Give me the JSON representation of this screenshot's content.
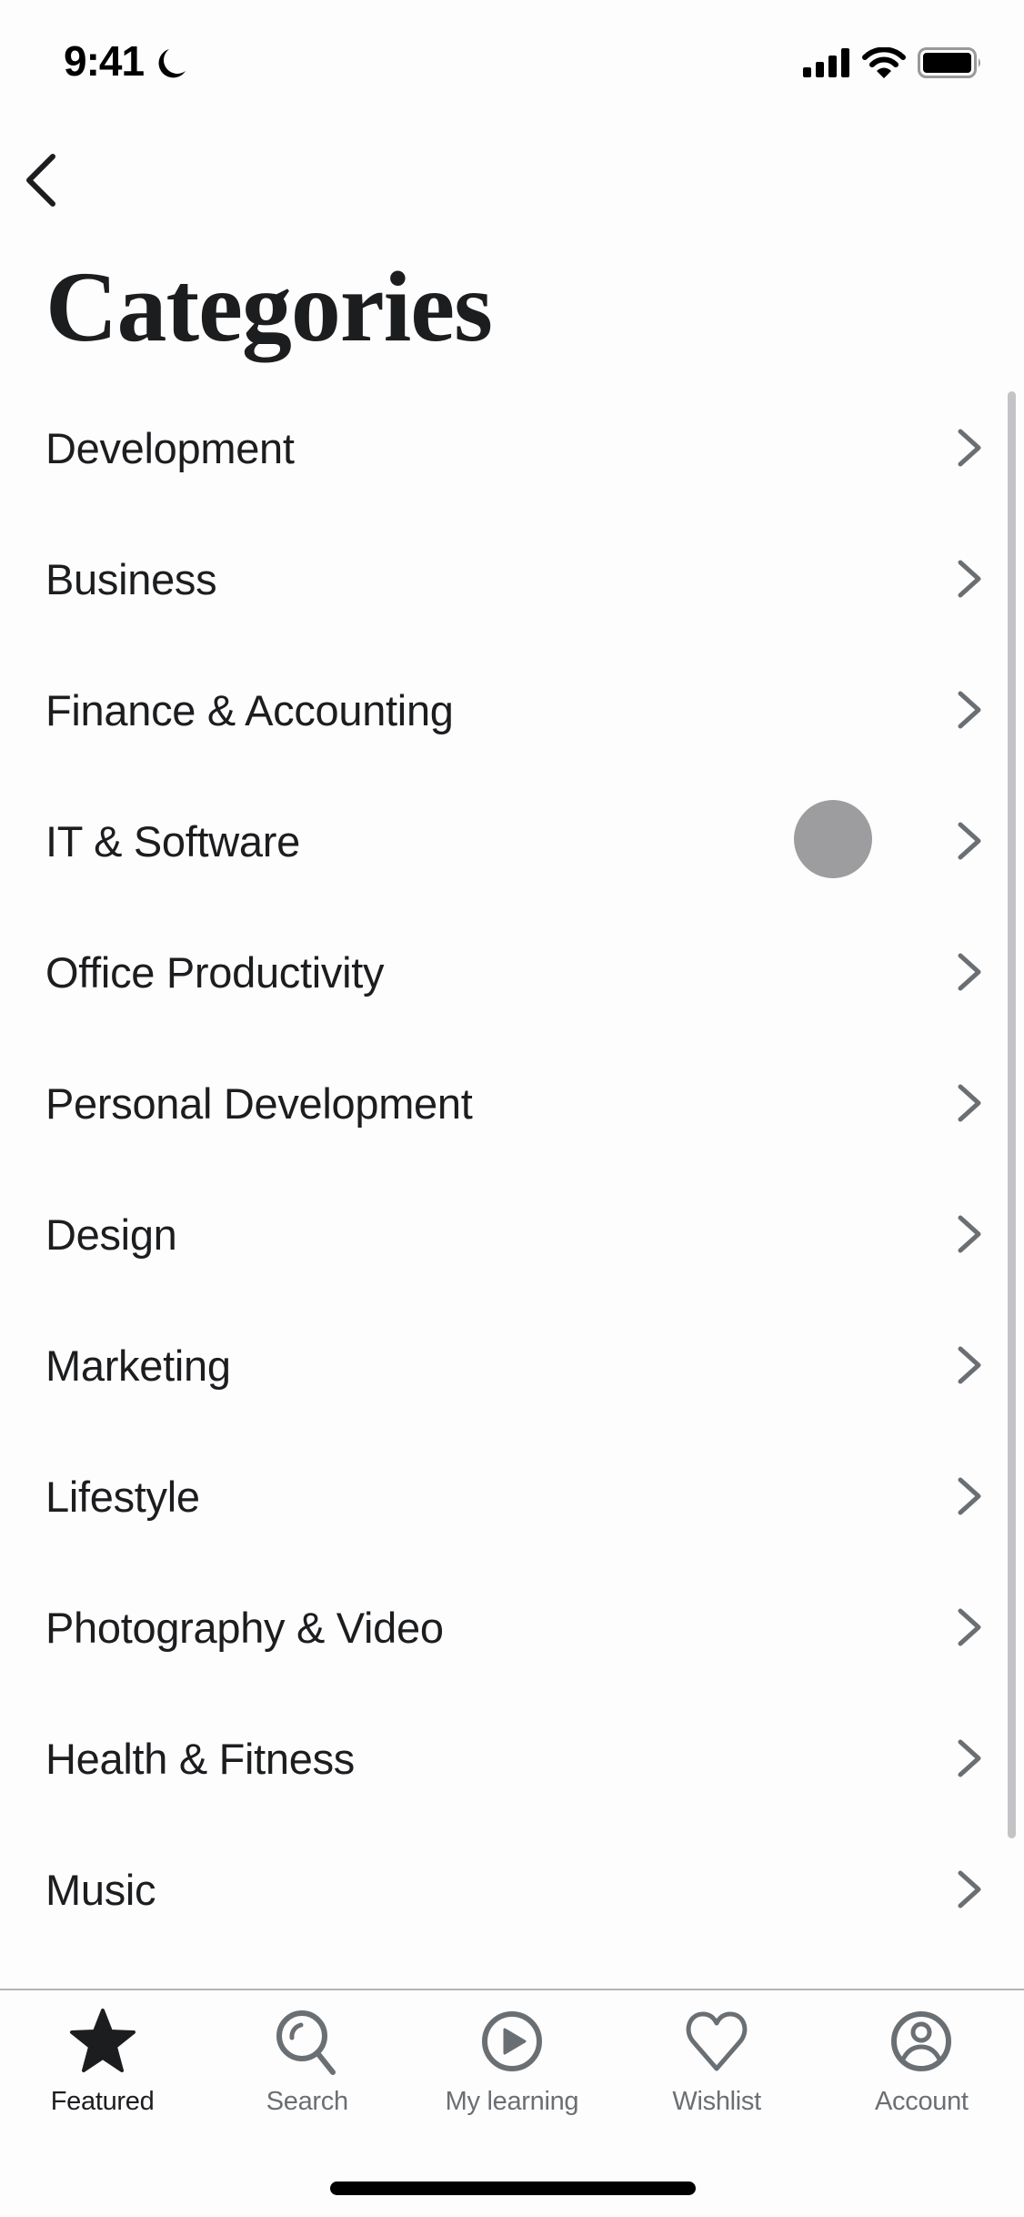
{
  "status_bar": {
    "time": "9:41",
    "focus_icon": "moon-icon",
    "signal_icon": "cellular-signal-icon",
    "wifi_icon": "wifi-icon",
    "battery_icon": "battery-icon"
  },
  "header": {
    "back_icon": "chevron-left-icon",
    "title": "Categories"
  },
  "categories": [
    {
      "label": "Development",
      "icon": "chevron-right-icon"
    },
    {
      "label": "Business",
      "icon": "chevron-right-icon"
    },
    {
      "label": "Finance & Accounting",
      "icon": "chevron-right-icon"
    },
    {
      "label": "IT & Software",
      "icon": "chevron-right-icon"
    },
    {
      "label": "Office Productivity",
      "icon": "chevron-right-icon"
    },
    {
      "label": "Personal Development",
      "icon": "chevron-right-icon"
    },
    {
      "label": "Design",
      "icon": "chevron-right-icon"
    },
    {
      "label": "Marketing",
      "icon": "chevron-right-icon"
    },
    {
      "label": "Lifestyle",
      "icon": "chevron-right-icon"
    },
    {
      "label": "Photography & Video",
      "icon": "chevron-right-icon"
    },
    {
      "label": "Health & Fitness",
      "icon": "chevron-right-icon"
    },
    {
      "label": "Music",
      "icon": "chevron-right-icon"
    }
  ],
  "tab_bar": {
    "active": "Featured",
    "tabs": [
      {
        "label": "Featured",
        "icon": "star-icon"
      },
      {
        "label": "Search",
        "icon": "search-icon"
      },
      {
        "label": "My learning",
        "icon": "play-circle-icon"
      },
      {
        "label": "Wishlist",
        "icon": "heart-icon"
      },
      {
        "label": "Account",
        "icon": "account-circle-icon"
      }
    ]
  },
  "colors": {
    "background": "#fefdfe",
    "text_primary": "#1c1d1f",
    "text_secondary": "#6a6f73",
    "chevron": "#6a6f73",
    "touch_indicator": "#9d9c9f",
    "divider": "#b3b3b6"
  }
}
